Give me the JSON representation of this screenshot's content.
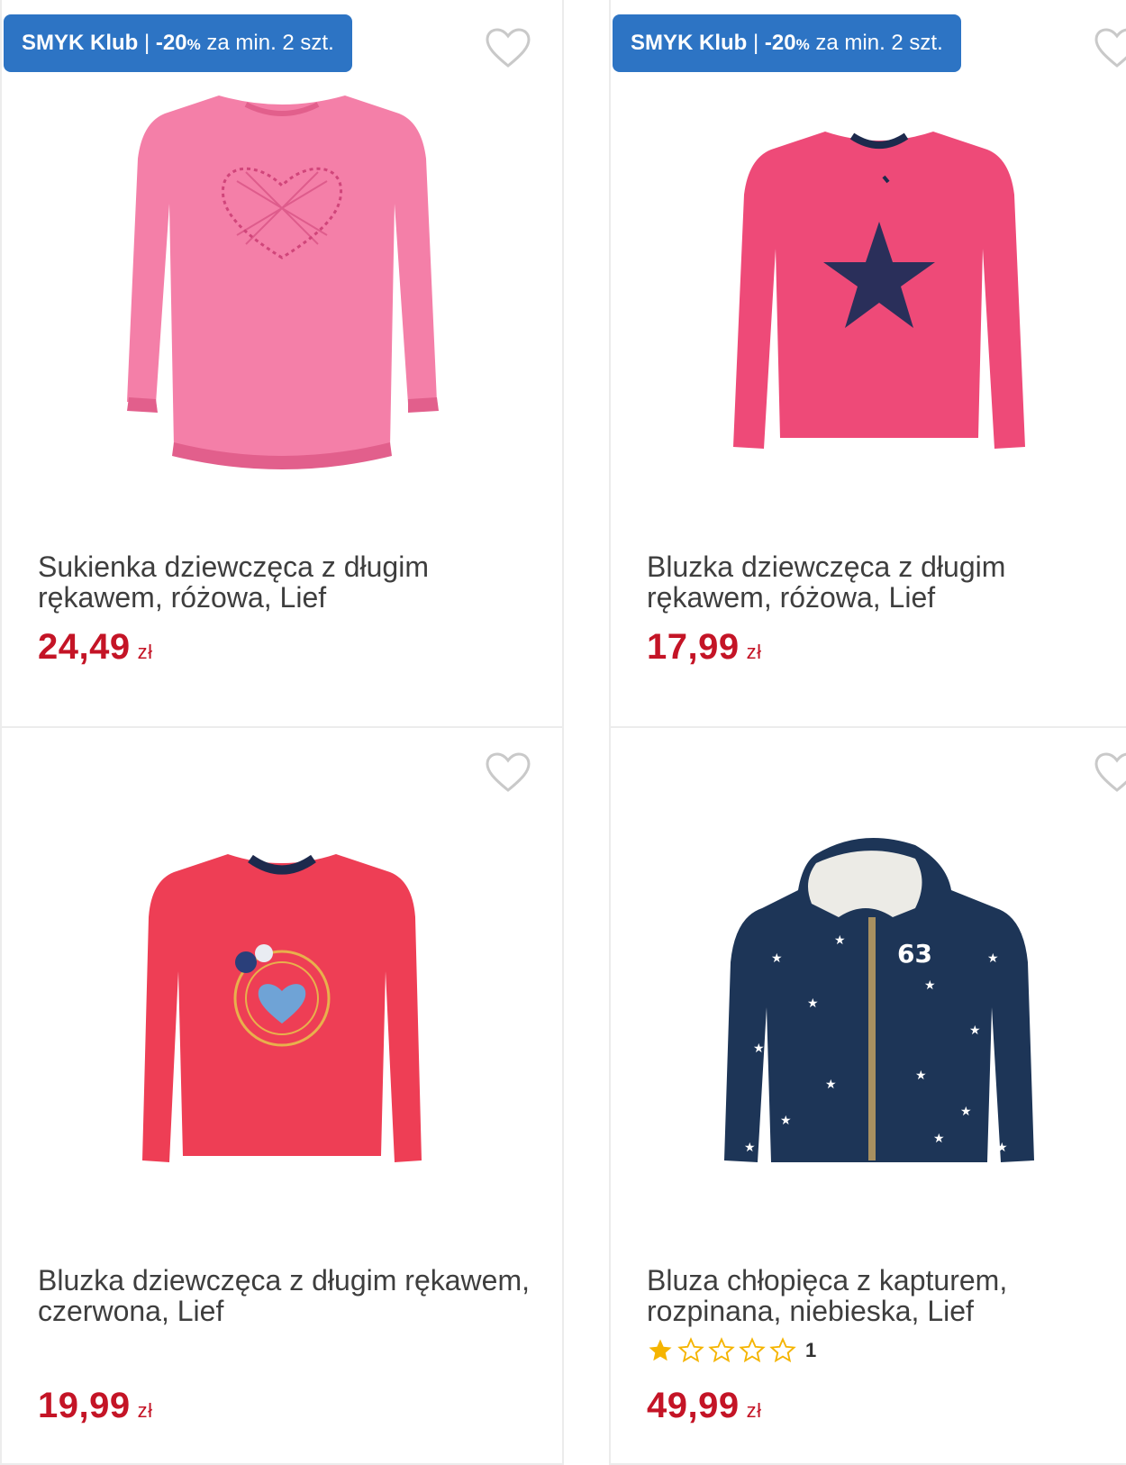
{
  "promo_badge": {
    "brand": "SMYK Klub",
    "separator": "|",
    "discount": "-20",
    "percent_sign": "%",
    "condition": "za min. 2 szt."
  },
  "products": [
    {
      "title": "Sukienka dziewczęca z długim rękawem, różowa, Lief",
      "price": "24,49",
      "currency": "zł",
      "has_badge": true,
      "garment_color": "#f47fa8"
    },
    {
      "title": "Bluzka dziewczęca z długim rękawem, różowa, Lief",
      "price": "17,99",
      "currency": "zł",
      "has_badge": true,
      "garment_color": "#ee4a78"
    },
    {
      "title": "Bluzka dziewczęca z długim rękawem, czerwona, Lief",
      "price": "19,99",
      "currency": "zł",
      "has_badge": false,
      "garment_color": "#ee3e55"
    },
    {
      "title": "Bluza chłopięca z kapturem, rozpinana, niebieska, Lief",
      "price": "49,99",
      "currency": "zł",
      "has_badge": false,
      "rating": 1,
      "rating_max": 5,
      "review_count": "1",
      "garment_color": "#1d3557"
    }
  ],
  "colors": {
    "price": "#c41426",
    "badge": "#2d74c4",
    "star_filled": "#f5b400"
  },
  "icons": {
    "wishlist": "heart-outline-icon",
    "rating": "star-icon"
  }
}
